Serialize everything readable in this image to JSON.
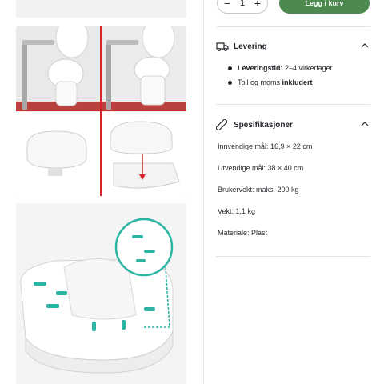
{
  "cart": {
    "quantity": "1",
    "minus": "−",
    "plus": "+",
    "button_label": "Legg i kurv"
  },
  "delivery": {
    "title": "Levering",
    "items": [
      {
        "label": "Leveringstid:",
        "value": " 2–4 virkedager"
      },
      {
        "prefix": "Toll og moms ",
        "bold": "inkludert"
      }
    ]
  },
  "specs": {
    "title": "Spesifikasjoner",
    "items": [
      "Innvendige mål: 16,9 × 22 cm",
      "Utvendige mål: 38 × 40 cm",
      "Brukervekt: maks. 200 kg",
      "Vekt: 1,1 kg",
      "Materiale: Plast"
    ]
  },
  "colors": {
    "accent": "#4c8a4f",
    "teal": "#2bb3a3",
    "red": "#d6252e"
  }
}
